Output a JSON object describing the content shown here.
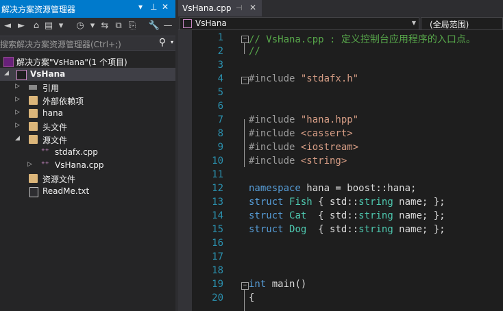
{
  "solution_explorer": {
    "title": "解决方案资源管理器",
    "search_placeholder": "搜索解决方案资源管理器(Ctrl+;)",
    "solution_label": "解决方案\"VsHana\"(1 个项目)",
    "project_label": "VsHana",
    "items": [
      {
        "label": "引用"
      },
      {
        "label": "外部依赖项"
      },
      {
        "label": "hana"
      },
      {
        "label": "头文件"
      },
      {
        "label": "源文件"
      },
      {
        "label": "stdafx.cpp"
      },
      {
        "label": "VsHana.cpp"
      },
      {
        "label": "资源文件"
      },
      {
        "label": "ReadMe.txt"
      }
    ]
  },
  "editor": {
    "tab_label": "VsHana.cpp",
    "nav_left": "VsHana",
    "nav_right": "(全局范围)",
    "lines": [
      {
        "n": "1",
        "parts": [
          {
            "t": "// VsHana.cpp : 定义控制台应用程序的入口点。",
            "c": "cmt"
          }
        ]
      },
      {
        "n": "2",
        "parts": [
          {
            "t": "//",
            "c": "cmt"
          }
        ]
      },
      {
        "n": "3",
        "parts": []
      },
      {
        "n": "4",
        "parts": [
          {
            "t": "#include ",
            "c": "pp"
          },
          {
            "t": "\"stdafx.h\"",
            "c": "str"
          }
        ]
      },
      {
        "n": "5",
        "parts": []
      },
      {
        "n": "6",
        "parts": []
      },
      {
        "n": "7",
        "parts": [
          {
            "t": "#include ",
            "c": "pp"
          },
          {
            "t": "\"hana.hpp\"",
            "c": "str"
          }
        ]
      },
      {
        "n": "8",
        "parts": [
          {
            "t": "#include ",
            "c": "pp"
          },
          {
            "t": "<cassert>",
            "c": "str"
          }
        ]
      },
      {
        "n": "9",
        "parts": [
          {
            "t": "#include ",
            "c": "pp"
          },
          {
            "t": "<iostream>",
            "c": "str"
          }
        ]
      },
      {
        "n": "10",
        "parts": [
          {
            "t": "#include ",
            "c": "pp"
          },
          {
            "t": "<string>",
            "c": "str"
          }
        ]
      },
      {
        "n": "11",
        "parts": []
      },
      {
        "n": "12",
        "parts": [
          {
            "t": "namespace",
            "c": "kw"
          },
          {
            "t": " hana = boost::hana;",
            "c": ""
          }
        ]
      },
      {
        "n": "13",
        "parts": [
          {
            "t": "struct",
            "c": "kw"
          },
          {
            "t": " ",
            "c": ""
          },
          {
            "t": "Fish",
            "c": "ty"
          },
          {
            "t": " { std::",
            "c": ""
          },
          {
            "t": "string",
            "c": "ty"
          },
          {
            "t": " name; };",
            "c": ""
          }
        ]
      },
      {
        "n": "14",
        "parts": [
          {
            "t": "struct",
            "c": "kw"
          },
          {
            "t": " ",
            "c": ""
          },
          {
            "t": "Cat",
            "c": "ty"
          },
          {
            "t": "  { std::",
            "c": ""
          },
          {
            "t": "string",
            "c": "ty"
          },
          {
            "t": " name; };",
            "c": ""
          }
        ]
      },
      {
        "n": "15",
        "parts": [
          {
            "t": "struct",
            "c": "kw"
          },
          {
            "t": " ",
            "c": ""
          },
          {
            "t": "Dog",
            "c": "ty"
          },
          {
            "t": "  { std::",
            "c": ""
          },
          {
            "t": "string",
            "c": "ty"
          },
          {
            "t": " name; };",
            "c": ""
          }
        ]
      },
      {
        "n": "16",
        "parts": []
      },
      {
        "n": "17",
        "parts": []
      },
      {
        "n": "18",
        "parts": []
      },
      {
        "n": "19",
        "parts": [
          {
            "t": "int",
            "c": "kw"
          },
          {
            "t": " main()",
            "c": ""
          }
        ]
      },
      {
        "n": "20",
        "parts": [
          {
            "t": "{",
            "c": ""
          }
        ]
      }
    ]
  },
  "colors": {
    "accent": "#007acc",
    "comment": "#57a64a",
    "keyword": "#569cd6",
    "string": "#d69d85",
    "type": "#4ec9b0",
    "line_number": "#2b91af"
  }
}
